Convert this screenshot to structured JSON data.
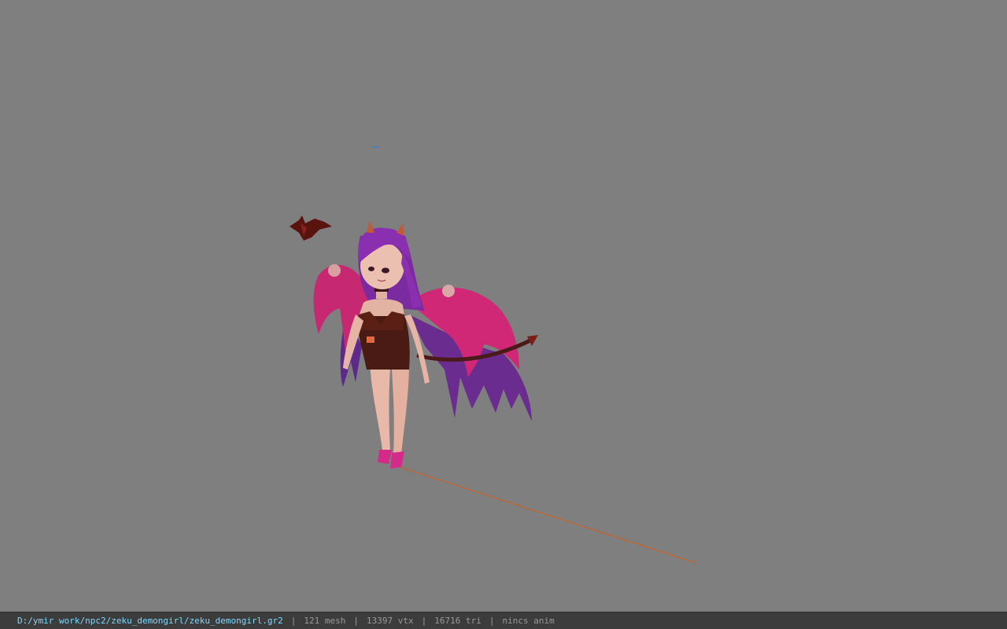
{
  "viewport": {
    "background": "#7f7f7f",
    "model": "zeku_demongirl",
    "separator": "|"
  },
  "status": {
    "path": "D:/ymir work/npc2/zeku_demongirl/zeku_demongirl.gr2",
    "mesh": "121 mesh",
    "vtx": "13397 vtx",
    "tri": "16716 tri",
    "anim": "nincs anim"
  },
  "colors": {
    "path": "#7fd8ff",
    "text": "#9a9a9a",
    "statusbar_bg": "#3c3c3c",
    "axis_line": "#c4632a"
  }
}
